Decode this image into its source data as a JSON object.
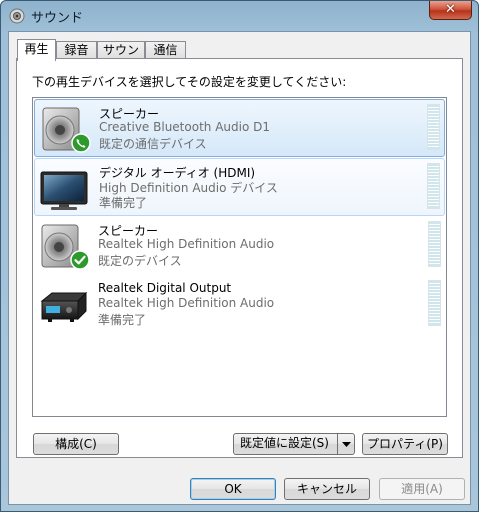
{
  "window": {
    "title": "サウンド",
    "close_label": "✕"
  },
  "tabs": [
    {
      "label": "再生",
      "active": true
    },
    {
      "label": "録音",
      "active": false
    },
    {
      "label": "サウンド",
      "active": false
    },
    {
      "label": "通信",
      "active": false
    }
  ],
  "instruction": "下の再生デバイスを選択してその設定を変更してください:",
  "devices": [
    {
      "name": "スピーカー",
      "description": "Creative Bluetooth Audio D1",
      "status": "既定の通信デバイス",
      "icon": "speaker-icon",
      "badge": "phone-badge-icon",
      "state": "selected"
    },
    {
      "name": "デジタル オーディオ (HDMI)",
      "description": "High Definition Audio デバイス",
      "status": "準備完了",
      "icon": "monitor-icon",
      "badge": "",
      "state": "hover"
    },
    {
      "name": "スピーカー",
      "description": "Realtek High Definition Audio",
      "status": "既定のデバイス",
      "icon": "speaker-icon",
      "badge": "check-badge-icon",
      "state": "normal"
    },
    {
      "name": "Realtek Digital Output",
      "description": "Realtek High Definition Audio",
      "status": "準備完了",
      "icon": "digital-output-icon",
      "badge": "",
      "state": "normal"
    }
  ],
  "buttons": {
    "configure": "構成(C)",
    "set_default": "既定値に設定(S)",
    "properties": "プロパティ(P)",
    "ok": "OK",
    "cancel": "キャンセル",
    "apply": "適用(A)"
  },
  "colors": {
    "selection_border": "#84acdd",
    "check_badge": "#2e9a2e",
    "phone_badge": "#2e9a2e"
  }
}
